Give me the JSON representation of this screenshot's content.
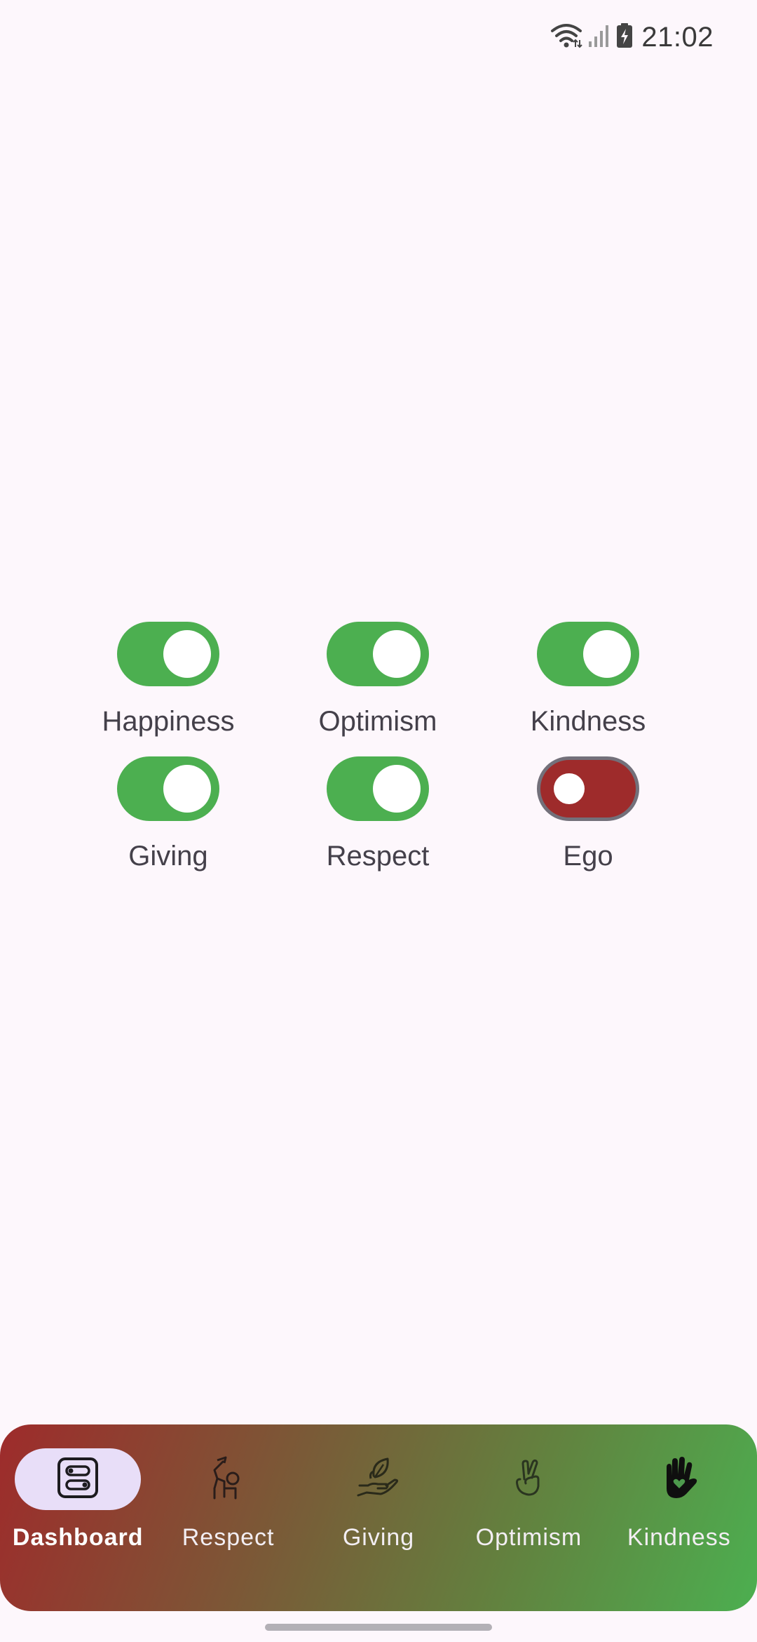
{
  "status_bar": {
    "time": "21:02",
    "icons": [
      "wifi-icon",
      "signal-icon",
      "battery-charging-icon"
    ]
  },
  "toggles": [
    {
      "label": "Happiness",
      "state": "on",
      "color": "#4caf50"
    },
    {
      "label": "Optimism",
      "state": "on",
      "color": "#4caf50"
    },
    {
      "label": "Kindness",
      "state": "on",
      "color": "#4caf50"
    },
    {
      "label": "Giving",
      "state": "on",
      "color": "#4caf50"
    },
    {
      "label": "Respect",
      "state": "on",
      "color": "#4caf50"
    },
    {
      "label": "Ego",
      "state": "off",
      "color": "#9e2b2b"
    }
  ],
  "bottom_nav": {
    "gradient": [
      "#9e2b2b",
      "#4caf50"
    ],
    "items": [
      {
        "label": "Dashboard",
        "icon": "dashboard-toggles-icon",
        "active": true
      },
      {
        "label": "Respect",
        "icon": "respect-bow-icon",
        "active": false
      },
      {
        "label": "Giving",
        "icon": "giving-hand-plant-icon",
        "active": false
      },
      {
        "label": "Optimism",
        "icon": "crossed-fingers-icon",
        "active": false
      },
      {
        "label": "Kindness",
        "icon": "hand-heart-icon",
        "active": false
      }
    ]
  }
}
